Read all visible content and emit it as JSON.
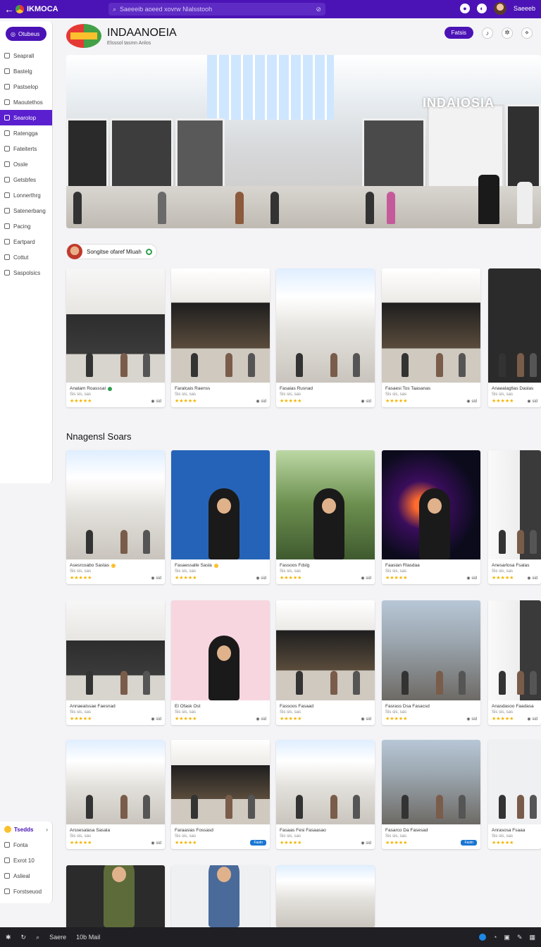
{
  "topbar": {
    "app_name": "IKMOCA",
    "search_placeholder": "Saeeeib aoeed xovrw Nlalsstooh",
    "user_name": "Saeeeb"
  },
  "sidebar": {
    "primary": "Otubeus",
    "items": [
      {
        "label": "Seaprall",
        "active": false
      },
      {
        "label": "Bastelg",
        "active": false
      },
      {
        "label": "Pastselop",
        "active": false
      },
      {
        "label": "Maoutethos",
        "active": false
      },
      {
        "label": "Searolop",
        "active": true
      },
      {
        "label": "Ratengga",
        "active": false
      },
      {
        "label": "Fateiterts",
        "active": false
      },
      {
        "label": "Ossle",
        "active": false
      },
      {
        "label": "Getsbfes",
        "active": false
      },
      {
        "label": "Lonnerthrg",
        "active": false
      },
      {
        "label": "Satenerbang",
        "active": false
      },
      {
        "label": "Pacing",
        "active": false
      },
      {
        "label": "Eartpard",
        "active": false
      },
      {
        "label": "Cottut",
        "active": false
      },
      {
        "label": "Saspolsics",
        "active": false
      }
    ]
  },
  "sidebar2": {
    "title": "Tsedds",
    "items": [
      "Fonta",
      "Exrot 10",
      "Aslieal",
      "Forstseuod"
    ]
  },
  "brand": {
    "title": "INDAANOEIA",
    "subtitle": "Elsssol tasmn Anlos"
  },
  "header": {
    "button": "Fatsis"
  },
  "hero": {
    "sign": "INDAIOSIA"
  },
  "chip": {
    "label": "Songitse ofaref Mluah"
  },
  "section": {
    "title": "Nnagensl Soars"
  },
  "row1": [
    {
      "cap": "Anatam Roasssal",
      "sub": "Sis sis, sas",
      "stars": "★★★★★",
      "meta": "sid"
    },
    {
      "cap": "Faralcais Raenss",
      "sub": "Sis sis, sas",
      "stars": "★★★★★",
      "meta": "sid"
    },
    {
      "cap": "Fasaias Rusnad",
      "sub": "Sis sis, sas",
      "stars": "★★★★★",
      "meta": "sid"
    },
    {
      "cap": "Fasaesi Tos Taasanas",
      "sub": "Sis sis, sas",
      "stars": "★★★★★",
      "meta": "sid"
    },
    {
      "cap": "Anaealagtlas Daslas",
      "sub": "Sis sis, sas",
      "stars": "★★★★★",
      "meta": "sid"
    }
  ],
  "row2": [
    {
      "cap": "Asesrcoabo Sastas",
      "sub": "Sis sis, sas",
      "stars": "★★★★★",
      "meta": "sid"
    },
    {
      "cap": "Fasaessalle Sasla",
      "sub": "Sis sis, sas",
      "stars": "★★★★★",
      "meta": "sid"
    },
    {
      "cap": "Fassoos Fdslg",
      "sub": "Sis sis, sas",
      "stars": "★★★★★",
      "meta": "sid"
    },
    {
      "cap": "Faasian Rlasdaa",
      "sub": "Sis sis, sas",
      "stars": "★★★★★",
      "meta": "sid"
    },
    {
      "cap": "Anesarlosa Fsalas",
      "sub": "Sis sis, sas",
      "stars": "★★★★★",
      "meta": "sid"
    }
  ],
  "row3": [
    {
      "cap": "Annaealssae Faesnad",
      "sub": "Sis sis, sas",
      "stars": "★★★★★",
      "meta": "sid"
    },
    {
      "cap": "El Ofask Ost",
      "sub": "Sis sis, sas",
      "stars": "★★★★★",
      "meta": "sid"
    },
    {
      "cap": "Fassoos Fasaad",
      "sub": "Sis sis, sas",
      "stars": "★★★★★",
      "meta": "sid"
    },
    {
      "cap": "Fasrass Dsa Fasacsd",
      "sub": "Sis sis, sas",
      "stars": "★★★★★",
      "meta": "sid"
    },
    {
      "cap": "Anasdasoo Faadasa",
      "sub": "Sis sis, sas",
      "stars": "★★★★★",
      "meta": "sid"
    }
  ],
  "row4": [
    {
      "cap": "Arssesalasa Sasala",
      "sub": "Sis sis, sas",
      "stars": "★★★★★",
      "meta": "sid"
    },
    {
      "cap": "Faraasias Fossasd",
      "sub": "Sis sis, sas",
      "stars": "★★★★★",
      "badge": "Fastn"
    },
    {
      "cap": "Fasaas Fesi Fasaasao",
      "sub": "Sis sis, sas",
      "stars": "★★★★★",
      "meta": "sid"
    },
    {
      "cap": "Fasarco Da Fasesad",
      "sub": "Sis sis, sas",
      "stars": "★★★★★",
      "badge": "Fastn"
    },
    {
      "cap": "Anrasosa Fsaaa",
      "sub": "Sis sis, sas",
      "stars": "★★★★★"
    }
  ],
  "taskbar": {
    "search": "Saere",
    "extra": "10b Mail"
  },
  "colors": {
    "brand": "#4b13b5",
    "star": "#f4b400",
    "badge": "#1976d2"
  }
}
